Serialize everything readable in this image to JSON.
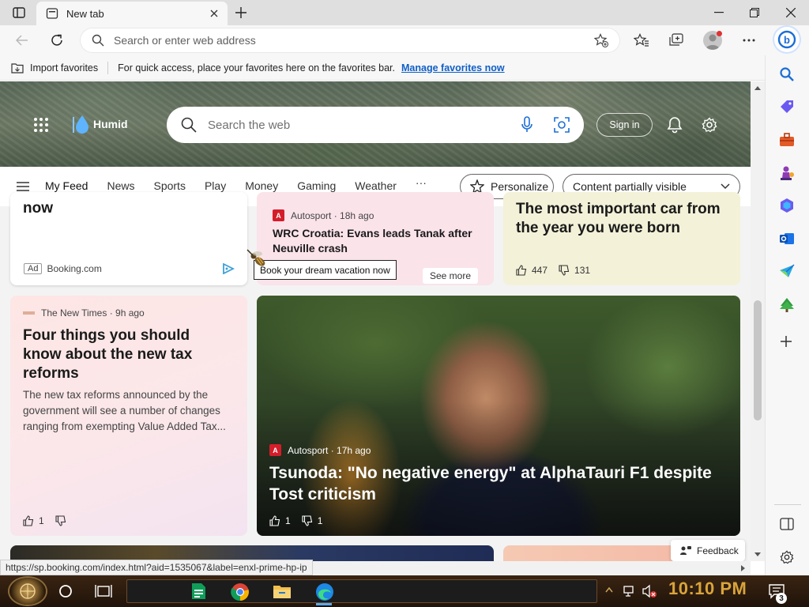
{
  "browser": {
    "tab_title": "New tab",
    "address_placeholder": "Search or enter web address"
  },
  "favorites_bar": {
    "import_label": "Import favorites",
    "hint": "For quick access, place your favorites here on the favorites bar.",
    "manage_link": "Manage favorites now"
  },
  "newtab": {
    "weather_label": "Humid",
    "search_placeholder": "Search the web",
    "signin_label": "Sign in",
    "nav": [
      "My Feed",
      "News",
      "Sports",
      "Play",
      "Money",
      "Gaming",
      "Weather"
    ],
    "more_label": "···",
    "personalize_label": "Personalize",
    "visibility_label": "Content partially visible"
  },
  "cards": {
    "ad": {
      "title_tail": "now",
      "ad_badge": "Ad",
      "source": "Booking.com"
    },
    "wrc": {
      "source": "Autosport · 18h ago",
      "headline": "WRC Croatia: Evans leads Tanak after Neuville crash",
      "see_more": "See more"
    },
    "tooltip": "Book your dream vacation now",
    "car": {
      "headline": "The most important car from the year you were born",
      "likes": "447",
      "dislikes": "131"
    },
    "tax": {
      "source": "The New Times · 9h ago",
      "headline": "Four things you should know about the new tax reforms",
      "summary": "The new tax reforms announced by the government will see a number of changes ranging from exempting Value Added Tax...",
      "likes": "1"
    },
    "f1": {
      "source": "Autosport · 17h ago",
      "headline": "Tsunoda: \"No negative energy\" at AlphaTauri F1 despite Tost criticism",
      "likes": "1",
      "dislikes": "1"
    }
  },
  "feedback_label": "Feedback",
  "status_url": "https://sp.booking.com/index.html?aid=1535067&label=enxl-prime-hp-ip",
  "taskbar": {
    "clock": "10:10 PM",
    "notification_count": "3"
  },
  "colors": {
    "accent_blue": "#0f5fc8",
    "autosport_red": "#d51d2a",
    "clock_gold": "#d9a43a"
  }
}
